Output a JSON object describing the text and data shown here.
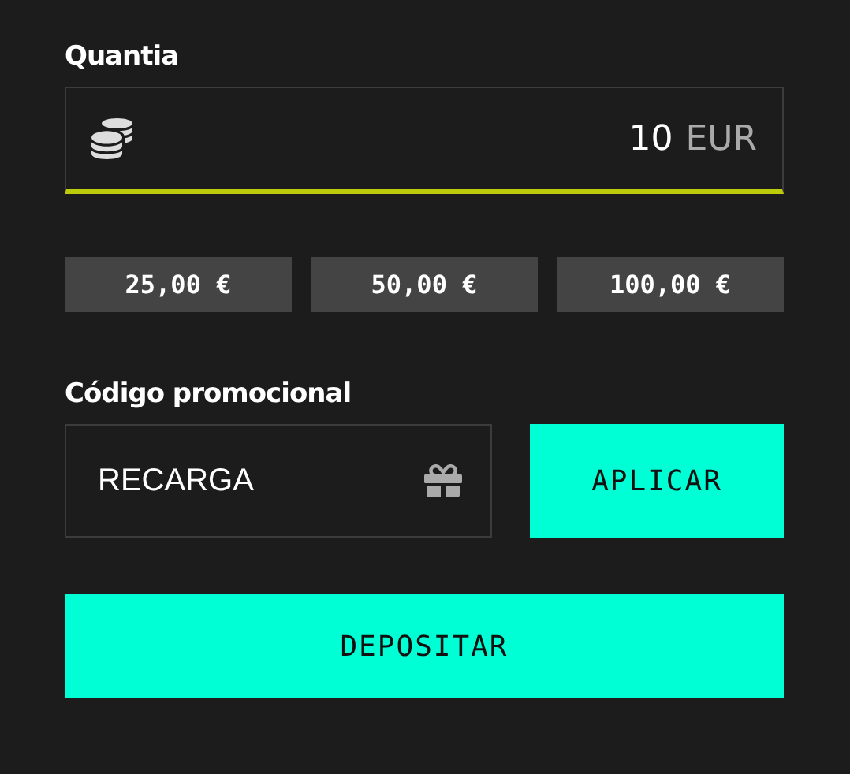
{
  "amount": {
    "label": "Quantia",
    "value": "10",
    "currency": "EUR"
  },
  "presets": [
    {
      "label": "25,00 €"
    },
    {
      "label": "50,00 €"
    },
    {
      "label": "100,00 €"
    }
  ],
  "promo": {
    "label": "Código promocional",
    "value": "RECARGA",
    "button": "APLICAR"
  },
  "submit": {
    "label": "DEPOSITAR"
  }
}
